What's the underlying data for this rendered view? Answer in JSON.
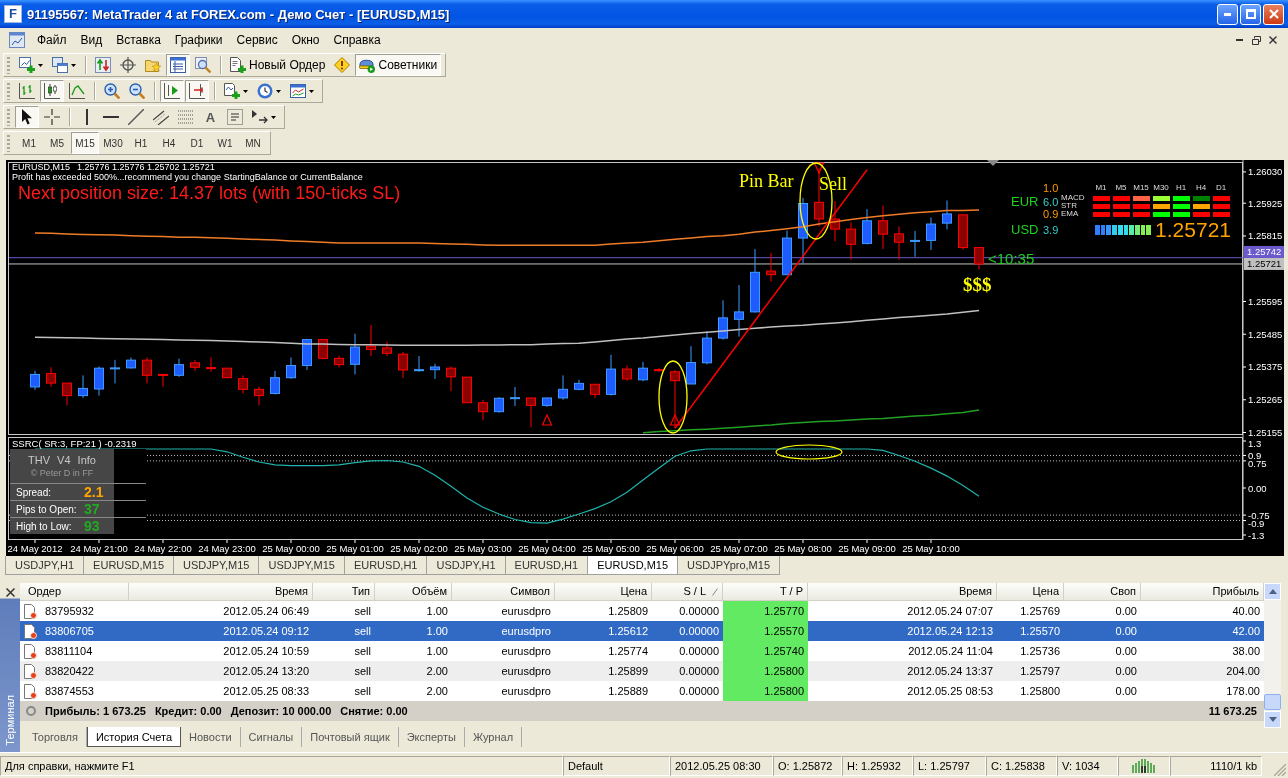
{
  "window": {
    "logo": "F",
    "title": "91195567: MetaTrader 4 at FOREX.com - Демо Счет - [EURUSD,M15]"
  },
  "menu": [
    "Файл",
    "Вид",
    "Вставка",
    "Графики",
    "Сервис",
    "Окно",
    "Справка"
  ],
  "toolbars": [
    {
      "groups": [
        [
          {
            "pressed": false
          },
          {
            "pressed": false
          }
        ],
        [
          {
            "pressed": false
          },
          {
            "pressed": false
          },
          {
            "pressed": false
          },
          {
            "pressed": true
          },
          {
            "pressed": false
          }
        ],
        [
          {
            "label": "Новый Ордер",
            "pressed": false
          },
          {
            "pressed": false
          },
          {
            "label": "Советники",
            "pressed": true
          }
        ]
      ]
    },
    {
      "groups": [
        [
          {
            "pressed": false
          },
          {
            "pressed": true
          },
          {
            "pressed": false
          }
        ],
        [
          {
            "pressed": false
          },
          {
            "pressed": false
          }
        ],
        [
          {
            "pressed": true
          },
          {
            "pressed": true
          }
        ],
        [
          {
            "pressed": false
          },
          {
            "pressed": false
          },
          {
            "pressed": false
          }
        ]
      ]
    },
    {
      "groups": [
        [
          {
            "pressed": true
          },
          {
            "pressed": false
          }
        ],
        [
          {
            "pressed": false
          },
          {
            "pressed": false
          },
          {
            "pressed": false
          },
          {
            "pressed": false
          },
          {
            "pressed": false
          },
          {
            "label": "A",
            "pressed": false
          },
          {
            "pressed": false
          },
          {
            "pressed": false
          }
        ]
      ]
    }
  ],
  "timeframes": [
    {
      "label": "M1",
      "selected": false
    },
    {
      "label": "M5",
      "selected": false
    },
    {
      "label": "M15",
      "selected": true
    },
    {
      "label": "M30",
      "selected": false
    },
    {
      "label": "H1",
      "selected": false
    },
    {
      "label": "H4",
      "selected": false
    },
    {
      "label": "D1",
      "selected": false
    },
    {
      "label": "W1",
      "selected": false
    },
    {
      "label": "MN",
      "selected": false
    }
  ],
  "chart": {
    "symbol": "EURUSD,M15",
    "quote": "1.25776 1.25776 1.25702 1.25721",
    "notice": "Profit has exceeded 500%...recommend you change StartingBalance or CurrentBalance",
    "position_size": "Next position size: 14.37 lots (with 150-ticks SL)",
    "strength_panel": {
      "timeframes": [
        "M1",
        "M5",
        "M15",
        "M30",
        "H1",
        "H4",
        "D1"
      ],
      "base": {
        "currency": "EUR",
        "score": "6.0",
        "change": "1.0"
      },
      "quote": {
        "currency": "USD",
        "score": "3.9",
        "change": "0.9"
      },
      "signals": [
        {
          "name": "MACD",
          "cells": [
            {
              "color": "#ff0000"
            },
            {
              "color": "#ff0000"
            },
            {
              "color": "#ff6347"
            },
            {
              "color": "#99ff33"
            },
            {
              "color": "#00ff00"
            },
            {
              "color": "#008000"
            },
            {
              "color": "#ff0000"
            }
          ]
        },
        {
          "name": "STR",
          "cells": [
            {
              "color": "#ff0000"
            },
            {
              "color": "#ff0000"
            },
            {
              "color": "#ff0000"
            },
            {
              "color": "#ffa500"
            },
            {
              "color": "#00ff00"
            },
            {
              "color": "#ffa500"
            },
            {
              "color": "#ff0000"
            }
          ]
        },
        {
          "name": "EMA",
          "cells": [
            {
              "color": "#ff0000"
            },
            {
              "color": "#ff0000"
            },
            {
              "color": "#ff0000"
            },
            {
              "color": "#00ff00"
            },
            {
              "color": "#00ff00"
            },
            {
              "color": "#ff0000"
            },
            {
              "color": "#ff0000"
            }
          ]
        }
      ],
      "meter": [
        {
          "color": "#2f7fff"
        },
        {
          "color": "#2f7fff"
        },
        {
          "color": "#3399ff"
        },
        {
          "color": "#33ccee"
        },
        {
          "color": "#33ddee"
        },
        {
          "color": "#33ddee"
        },
        {
          "color": "#55eeaa"
        },
        {
          "color": "#77ee77"
        },
        {
          "color": "#88ee55"
        },
        {
          "color": "#88ee55"
        }
      ],
      "price": "1.25721"
    },
    "info_panel": {
      "title": "THV V4 Info",
      "credit": "© Peter D in FF",
      "rows": [
        {
          "label": "Spread:",
          "value": "2.1",
          "color": "#ffa500"
        },
        {
          "label": "Pips to Open:",
          "value": "37",
          "color": "#22aa22"
        },
        {
          "label": "High to Low:",
          "value": "93",
          "color": "#22aa22"
        }
      ]
    },
    "chart_data": [
      {
        "type": "candlestick",
        "ohlc": [
          [
            1.25308,
            1.25362,
            1.25298,
            1.2535
          ],
          [
            1.25353,
            1.25374,
            1.25309,
            1.25321
          ],
          [
            1.25321,
            1.25321,
            1.25246,
            1.25279
          ],
          [
            1.25279,
            1.25347,
            1.25271,
            1.25303
          ],
          [
            1.25301,
            1.25377,
            1.25279,
            1.25371
          ],
          [
            1.25371,
            1.25399,
            1.2532,
            1.25372
          ],
          [
            1.25372,
            1.25407,
            1.25369,
            1.25398
          ],
          [
            1.25398,
            1.25407,
            1.2532,
            1.25347
          ],
          [
            1.2535,
            1.2535,
            1.25309,
            1.25349
          ],
          [
            1.25347,
            1.25403,
            1.25342,
            1.25383
          ],
          [
            1.25389,
            1.25398,
            1.25362,
            1.25374
          ],
          [
            1.25373,
            1.25407,
            1.25359,
            1.25372
          ],
          [
            1.25371,
            1.25371,
            1.25339,
            1.25339
          ],
          [
            1.25336,
            1.25347,
            1.25286,
            1.253
          ],
          [
            1.253,
            1.25309,
            1.25246,
            1.25279
          ],
          [
            1.25286,
            1.25362,
            1.25283,
            1.25339
          ],
          [
            1.25339,
            1.25407,
            1.25335,
            1.2538
          ],
          [
            1.2538,
            1.2547,
            1.25365,
            1.25467
          ],
          [
            1.25467,
            1.25467,
            1.25401,
            1.25404
          ],
          [
            1.25404,
            1.25413,
            1.25374,
            1.25383
          ],
          [
            1.25384,
            1.25487,
            1.2535,
            1.25442
          ],
          [
            1.25445,
            1.25516,
            1.25412,
            1.25434
          ],
          [
            1.25439,
            1.2546,
            1.25412,
            1.25421
          ],
          [
            1.25418,
            1.25425,
            1.25338,
            1.25365
          ],
          [
            1.25365,
            1.25412,
            1.25359,
            1.25366
          ],
          [
            1.25366,
            1.25386,
            1.25335,
            1.25375
          ],
          [
            1.25371,
            1.25377,
            1.25294,
            1.25342
          ],
          [
            1.25341,
            1.25341,
            1.25255,
            1.25255
          ],
          [
            1.25255,
            1.25264,
            1.25196,
            1.25225
          ],
          [
            1.25225,
            1.25274,
            1.25222,
            1.2527
          ],
          [
            1.25271,
            1.25308,
            1.25244,
            1.25272
          ],
          [
            1.25271,
            1.25271,
            1.25173,
            1.25246
          ],
          [
            1.25246,
            1.25271,
            1.25241,
            1.25271
          ],
          [
            1.25271,
            1.25347,
            1.25265,
            1.253
          ],
          [
            1.253,
            1.25332,
            1.25297,
            1.2532
          ],
          [
            1.25317,
            1.25317,
            1.25271,
            1.25283
          ],
          [
            1.25283,
            1.25416,
            1.25279,
            1.25368
          ],
          [
            1.25368,
            1.2538,
            1.25329,
            1.25335
          ],
          [
            1.25332,
            1.25392,
            1.25327,
            1.25371
          ],
          [
            1.25366,
            1.25372,
            1.25359,
            1.25365
          ],
          [
            1.25359,
            1.25365,
            1.25169,
            1.25329
          ],
          [
            1.25318,
            1.25445,
            1.25317,
            1.2539
          ],
          [
            1.25389,
            1.25494,
            1.25384,
            1.25472
          ],
          [
            1.25472,
            1.25599,
            1.25467,
            1.2554
          ],
          [
            1.25535,
            1.2565,
            1.25477,
            1.2556
          ],
          [
            1.2556,
            1.25771,
            1.25558,
            1.25693
          ],
          [
            1.25697,
            1.25758,
            1.25662,
            1.25685
          ],
          [
            1.25685,
            1.25833,
            1.25684,
            1.25808
          ],
          [
            1.25808,
            1.25943,
            1.25722,
            1.25924
          ],
          [
            1.25928,
            1.26042,
            1.25847,
            1.25872
          ],
          [
            1.25872,
            1.25932,
            1.25797,
            1.25838
          ],
          [
            1.25838,
            1.2586,
            1.25736,
            1.25787
          ],
          [
            1.2579,
            1.25905,
            1.25787,
            1.25866
          ],
          [
            1.25866,
            1.25917,
            1.25771,
            1.25821
          ],
          [
            1.25822,
            1.25847,
            1.25736,
            1.25794
          ],
          [
            1.25799,
            1.25832,
            1.25745,
            1.258
          ],
          [
            1.258,
            1.25877,
            1.25768,
            1.25855
          ],
          [
            1.25858,
            1.25934,
            1.25837,
            1.25889
          ],
          [
            1.25886,
            1.25886,
            1.25769,
            1.25776
          ],
          [
            1.25776,
            1.25776,
            1.25702,
            1.25721
          ]
        ],
        "series": [
          {
            "type": "line",
            "color": "#f07c28",
            "values": [
              1.25825,
              1.25824,
              1.25822,
              1.2582,
              1.25819,
              1.25818,
              1.25816,
              1.25814,
              1.25813,
              1.25811,
              1.25811,
              1.25809,
              1.25807,
              1.25805,
              1.25803,
              1.25801,
              1.25798,
              1.25796,
              1.25794,
              1.25791,
              1.25791,
              1.25791,
              1.25791,
              1.25791,
              1.25791,
              1.2579,
              1.25788,
              1.25787,
              1.25785,
              1.25784,
              1.25784,
              1.25784,
              1.25784,
              1.25784,
              1.25784,
              1.25784,
              1.25788,
              1.25791,
              1.25794,
              1.25799,
              1.25804,
              1.25808,
              1.25813,
              1.25816,
              1.25821,
              1.25828,
              1.25833,
              1.25839,
              1.25846,
              1.25855,
              1.25863,
              1.2587,
              1.25877,
              1.25883,
              1.25888,
              1.25893,
              1.25896,
              1.259,
              1.25901,
              1.25902
            ]
          },
          {
            "type": "line",
            "color": "#c0c0c0",
            "values": [
              1.25475,
              1.25474,
              1.25473,
              1.25472,
              1.25471,
              1.2547,
              1.25469,
              1.25468,
              1.25467,
              1.25466,
              1.25465,
              1.25464,
              1.25462,
              1.25461,
              1.25459,
              1.25457,
              1.25455,
              1.25452,
              1.25452,
              1.25451,
              1.2545,
              1.2545,
              1.25449,
              1.25448,
              1.25448,
              1.25448,
              1.25448,
              1.25448,
              1.25449,
              1.25449,
              1.2545,
              1.2545,
              1.25452,
              1.25454,
              1.25455,
              1.25459,
              1.25464,
              1.25469,
              1.25472,
              1.25477,
              1.25482,
              1.25487,
              1.25492,
              1.25496,
              1.25501,
              1.25505,
              1.25509,
              1.25513,
              1.25515,
              1.25519,
              1.25523,
              1.25527,
              1.25532,
              1.25536,
              1.25541,
              1.25545,
              1.25549,
              1.25553,
              1.25559,
              1.25565
            ]
          },
          {
            "type": "line",
            "color": "#22a022",
            "values": [
              null,
              null,
              null,
              null,
              null,
              null,
              null,
              null,
              null,
              null,
              null,
              null,
              null,
              null,
              null,
              null,
              null,
              null,
              null,
              null,
              null,
              null,
              null,
              null,
              null,
              null,
              null,
              null,
              null,
              null,
              null,
              null,
              null,
              null,
              null,
              null,
              null,
              null,
              1.25154,
              1.25158,
              1.25161,
              1.25164,
              1.25166,
              1.25169,
              1.25173,
              1.25177,
              1.2518,
              1.25185,
              1.25189,
              1.25192,
              1.25194,
              1.25197,
              1.252,
              1.25202,
              1.25206,
              1.2521,
              1.25213,
              1.25218,
              1.25222,
              1.25231
            ]
          },
          {
            "type": "line",
            "color": "#ff0000",
            "values": [
              null,
              null,
              null,
              null,
              null,
              null,
              null,
              null,
              null,
              null,
              null,
              null,
              null,
              null,
              null,
              null,
              null,
              null,
              null,
              null,
              null,
              null,
              null,
              null,
              null,
              null,
              null,
              null,
              null,
              null,
              null,
              null,
              null,
              null,
              null,
              null,
              null,
              null,
              null,
              null,
              1.25169,
              1.25241,
              1.25313,
              1.25386,
              1.25458,
              1.2553,
              1.25603,
              1.25675,
              1.25747,
              1.2582,
              1.25892,
              1.25964,
              1.26037,
              null,
              null,
              null,
              null,
              null,
              null,
              null
            ]
          },
          {
            "type": "scatter",
            "marker": "triangle",
            "color": "#ff0000",
            "values": [
              null,
              null,
              null,
              null,
              null,
              null,
              null,
              null,
              null,
              null,
              null,
              null,
              null,
              null,
              null,
              null,
              null,
              null,
              null,
              null,
              null,
              null,
              null,
              null,
              null,
              null,
              null,
              null,
              null,
              null,
              null,
              null,
              1.25197,
              null,
              null,
              null,
              null,
              null,
              null,
              null,
              1.25197,
              null,
              null,
              null,
              null,
              null,
              null,
              null,
              null,
              1.26043,
              null,
              null,
              null,
              null,
              null,
              null,
              null,
              null,
              null,
              null
            ]
          }
        ],
        "ylim": [
          1.2515,
          1.2606
        ],
        "yticks": [
          {
            "value": 1.2603,
            "label": "1.26030"
          },
          {
            "value": 1.25925,
            "label": "1.25925"
          },
          {
            "value": 1.25815,
            "label": "1.25815"
          },
          {
            "value": 1.25595,
            "label": "1.25595"
          },
          {
            "value": 1.25485,
            "label": "1.25485"
          },
          {
            "value": 1.25375,
            "label": "1.25375"
          },
          {
            "value": 1.25265,
            "label": "1.25265"
          },
          {
            "value": 1.25155,
            "label": "1.25155"
          }
        ],
        "ref_lines": [
          {
            "axis": "y",
            "value": 1.25742,
            "label": "1.25742",
            "color": "#6a5acd"
          },
          {
            "axis": "y",
            "value": 1.25721,
            "label": "1.25721",
            "color": "#c0c0c0"
          }
        ],
        "annotations": [
          "Pin Bar",
          "Sell",
          "$$$",
          "<10:35"
        ]
      },
      {
        "type": "line",
        "title": "SSRC( SR:3, FP:21 ) -0.2319",
        "color": "#20b2aa",
        "categories": [
          "24 May 2012",
          null,
          null,
          null,
          "24 May 21:00",
          null,
          null,
          null,
          "24 May 22:00",
          null,
          null,
          null,
          "24 May 23:00",
          null,
          null,
          null,
          "25 May 00:00",
          null,
          null,
          null,
          "25 May 01:00",
          null,
          null,
          null,
          "25 May 02:00",
          null,
          null,
          null,
          "25 May 03:00",
          null,
          null,
          null,
          "25 May 04:00",
          null,
          null,
          null,
          "25 May 05:00",
          null,
          null,
          null,
          "25 May 06:00",
          null,
          null,
          null,
          "25 May 07:00",
          null,
          null,
          null,
          "25 May 08:00",
          null,
          null,
          null,
          "25 May 09:00",
          null,
          null,
          null,
          "25 May 10:00",
          null,
          null,
          null
        ],
        "values": [
          1.08,
          1.08,
          1.08,
          1.08,
          1.08,
          1.08,
          1.08,
          1.08,
          1.08,
          1.08,
          1.08,
          1.08,
          1.0,
          0.85,
          0.72,
          0.64,
          0.62,
          0.62,
          0.62,
          0.64,
          0.7,
          0.75,
          0.76,
          0.72,
          0.6,
          0.35,
          0.05,
          -0.28,
          -0.53,
          -0.72,
          -0.87,
          -0.96,
          -0.97,
          -0.86,
          -0.72,
          -0.57,
          -0.38,
          -0.12,
          0.22,
          0.55,
          0.88,
          1.03,
          1.08,
          1.08,
          1.08,
          1.08,
          1.08,
          1.08,
          1.08,
          1.08,
          1.08,
          1.08,
          1.08,
          1.04,
          0.9,
          0.74,
          0.55,
          0.33,
          0.07,
          -0.23
        ],
        "ylim": [
          -1.3,
          1.3
        ],
        "yticks": [
          {
            "value": 1.3,
            "label": "1.3"
          },
          {
            "value": 0.9,
            "label": "0.9"
          },
          {
            "value": 0.75,
            "label": "0.75"
          },
          {
            "value": 0,
            "label": "0.00"
          },
          {
            "value": -0.75,
            "label": "-0.75"
          },
          {
            "value": -0.9,
            "label": "-0.9"
          },
          {
            "value": -1.3,
            "label": "-1.3"
          }
        ],
        "ref_lines": [
          {
            "axis": "y",
            "value": 0.9,
            "line_style": "dotted"
          },
          {
            "axis": "y",
            "value": 0.75,
            "line_style": "dotted"
          },
          {
            "axis": "y",
            "value": -0.75,
            "line_style": "dotted"
          },
          {
            "axis": "y",
            "value": -0.9,
            "line_style": "dotted"
          }
        ]
      }
    ]
  },
  "chart_tabs": [
    {
      "label": "USDJPY,H1",
      "selected": false
    },
    {
      "label": "EURUSD,M15",
      "selected": false
    },
    {
      "label": "USDJPY,M15",
      "selected": false
    },
    {
      "label": "USDJPY,M15",
      "selected": false
    },
    {
      "label": "EURUSD,H1",
      "selected": false
    },
    {
      "label": "USDJPY,H1",
      "selected": false
    },
    {
      "label": "EURUSD,H1",
      "selected": false
    },
    {
      "label": "EURUSD,M15",
      "selected": true
    },
    {
      "label": "USDJPYpro,M15",
      "selected": false
    }
  ],
  "terminal": {
    "label": "Терминал",
    "columns": [
      {
        "label": "Ордер",
        "sorted": false
      },
      {
        "label": "Время",
        "sorted": false
      },
      {
        "label": "Тип",
        "sorted": false
      },
      {
        "label": "Объём",
        "sorted": false
      },
      {
        "label": "Символ",
        "sorted": false
      },
      {
        "label": "Цена",
        "sorted": false
      },
      {
        "label": "S / L",
        "sorted": true
      },
      {
        "label": "T / P",
        "sorted": false
      },
      {
        "label": "Время",
        "sorted": false
      },
      {
        "label": "Цена",
        "sorted": false
      },
      {
        "label": "Своп",
        "sorted": false
      },
      {
        "label": "Прибыль",
        "sorted": false
      }
    ],
    "rows": [
      {
        "cells": [
          "83795932",
          "2012.05.24 06:49",
          "sell",
          "1.00",
          "eurusdpro",
          "1.25809",
          "0.00000",
          "1.25770",
          "2012.05.24 07:07",
          "1.25769",
          "0.00",
          "40.00"
        ],
        "selected": false,
        "tp_highlighted": true
      },
      {
        "cells": [
          "83806705",
          "2012.05.24 09:12",
          "sell",
          "1.00",
          "eurusdpro",
          "1.25612",
          "0.00000",
          "1.25570",
          "2012.05.24 12:13",
          "1.25570",
          "0.00",
          "42.00"
        ],
        "selected": true,
        "tp_highlighted": true
      },
      {
        "cells": [
          "83811104",
          "2012.05.24 10:59",
          "sell",
          "1.00",
          "eurusdpro",
          "1.25774",
          "0.00000",
          "1.25740",
          "2012.05.24 11:04",
          "1.25736",
          "0.00",
          "38.00"
        ],
        "selected": false,
        "tp_highlighted": true
      },
      {
        "cells": [
          "83820422",
          "2012.05.24 13:20",
          "sell",
          "2.00",
          "eurusdpro",
          "1.25899",
          "0.00000",
          "1.25800",
          "2012.05.24 13:37",
          "1.25797",
          "0.00",
          "204.00"
        ],
        "selected": false,
        "tp_highlighted": true
      },
      {
        "cells": [
          "83874553",
          "2012.05.25 08:33",
          "sell",
          "2.00",
          "eurusdpro",
          "1.25889",
          "0.00000",
          "1.25800",
          "2012.05.25 08:53",
          "1.25800",
          "0.00",
          "178.00"
        ],
        "selected": false,
        "tp_highlighted": true
      }
    ],
    "summary": {
      "items": [
        "Прибыль: 1 673.25",
        "Кредит: 0.00",
        "Депозит: 10 000.00",
        "Снятие: 0.00"
      ],
      "total": "11 673.25"
    },
    "tabs": [
      {
        "label": "Торговля",
        "selected": false
      },
      {
        "label": "История Счета",
        "selected": true
      },
      {
        "label": "Новости",
        "selected": false
      },
      {
        "label": "Сигналы",
        "selected": false
      },
      {
        "label": "Почтовый ящик",
        "selected": false
      },
      {
        "label": "Эксперты",
        "selected": false
      },
      {
        "label": "Журнал",
        "selected": false
      }
    ]
  },
  "status_bar": {
    "sections": [
      "Для справки, нажмите F1",
      "Default",
      "2012.05.25 08:30",
      "O: 1.25872",
      "H: 1.25932",
      "L: 1.25797",
      "C: 1.25838",
      "V: 1034",
      "1110/1 kb"
    ]
  }
}
